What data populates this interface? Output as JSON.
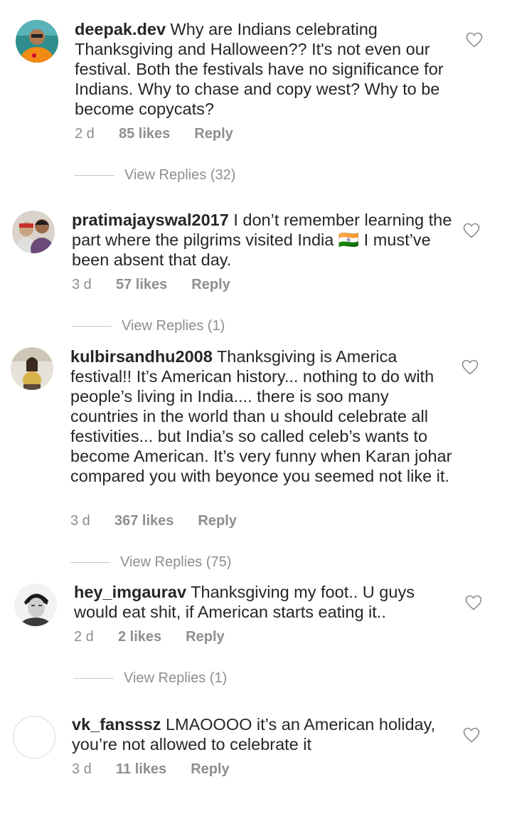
{
  "comments": [
    {
      "username": "deepak.dev",
      "text": "Why are Indians celebrating Thanksgiving and Halloween?? It's not even our festival. Both the festivals have no significance for Indians. Why to chase and copy west? Why to be become copycats?",
      "age": "2 d",
      "likes": "85 likes",
      "reply": "Reply",
      "view_replies": "View Replies (32)"
    },
    {
      "username": "pratimajayswal2017",
      "text": "I don’t remember learning the part where the  pilgrims visited India 🇮🇳 I must’ve been absent that day.",
      "age": "3 d",
      "likes": "57 likes",
      "reply": "Reply",
      "view_replies": "View Replies (1)"
    },
    {
      "username": "kulbirsandhu2008",
      "text": "Thanksgiving is America festival!! It’s American history... nothing to do with people’s living in India.... there is soo many countries in the world than u should celebrate all festivities... but India’s so called celeb’s wants to become American. It’s very funny when Karan johar compared you with beyonce you seemed not like it.",
      "age": "3 d",
      "likes": "367 likes",
      "reply": "Reply",
      "view_replies": "View Replies (75)"
    },
    {
      "username": "hey_imgaurav",
      "text": "Thanksgiving my foot.. U guys would eat shit, if American starts eating it..",
      "age": "2 d",
      "likes": "2 likes",
      "reply": "Reply",
      "view_replies": "View Replies (1)"
    },
    {
      "username": "vk_fansssz",
      "text": "LMAOOOO it’s an American holiday, you’re not allowed to celebrate it",
      "age": "3 d",
      "likes": "11 likes",
      "reply": "Reply"
    }
  ],
  "icons": {
    "like": "heart-outline-icon"
  }
}
